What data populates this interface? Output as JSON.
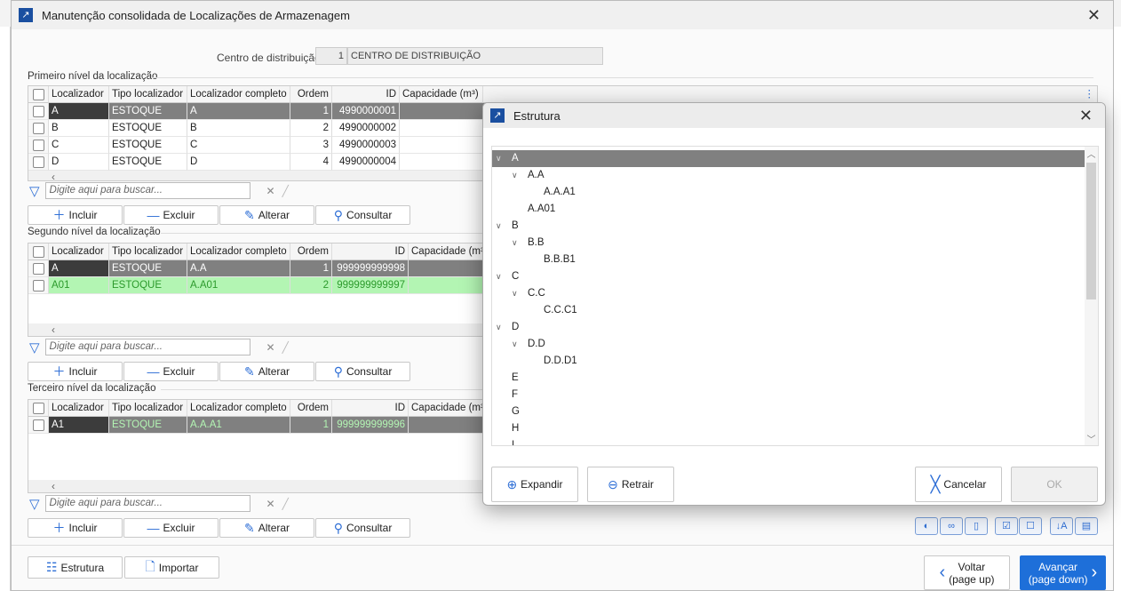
{
  "window": {
    "title": "Manutenção consolidada de Localizações de Armazenagem"
  },
  "distribution": {
    "label": "Centro de distribuição",
    "code": "1",
    "name": "CENTRO DE DISTRIBUIÇÃO"
  },
  "columns": [
    "Localizador",
    "Tipo localizador",
    "Localizador completo",
    "Ordem",
    "ID",
    "Capacidade (m³)"
  ],
  "levels": [
    {
      "title": "Primeiro nível da localização",
      "rows": [
        {
          "localizador": "A",
          "tipo": "ESTOQUE",
          "completo": "A",
          "ordem": "1",
          "id": "4990000001",
          "state": "selected"
        },
        {
          "localizador": "B",
          "tipo": "ESTOQUE",
          "completo": "B",
          "ordem": "2",
          "id": "4990000002",
          "state": "normal"
        },
        {
          "localizador": "C",
          "tipo": "ESTOQUE",
          "completo": "C",
          "ordem": "3",
          "id": "4990000003",
          "state": "normal"
        },
        {
          "localizador": "D",
          "tipo": "ESTOQUE",
          "completo": "D",
          "ordem": "4",
          "id": "4990000004",
          "state": "normal"
        }
      ]
    },
    {
      "title": "Segundo nível da localização",
      "rows": [
        {
          "localizador": "A",
          "tipo": "ESTOQUE",
          "completo": "A.A",
          "ordem": "1",
          "id": "999999999998",
          "state": "selected"
        },
        {
          "localizador": "A01",
          "tipo": "ESTOQUE",
          "completo": "A.A01",
          "ordem": "2",
          "id": "999999999997",
          "state": "green"
        }
      ]
    },
    {
      "title": "Terceiro nível da localização",
      "rows": [
        {
          "localizador": "A1",
          "tipo": "ESTOQUE",
          "completo": "A.A.A1",
          "ordem": "1",
          "id": "999999999996",
          "state": "selected-green"
        }
      ]
    }
  ],
  "search": {
    "placeholder": "Digite aqui para buscar..."
  },
  "actions": {
    "add": "Incluir",
    "delete": "Excluir",
    "edit": "Alterar",
    "query": "Consultar"
  },
  "footer": {
    "structure": "Estrutura",
    "import": "Importar",
    "back": "Voltar",
    "back_sub": "(page up)",
    "next": "Avançar",
    "next_sub": "(page down)"
  },
  "dialog": {
    "title": "Estrutura",
    "tree": [
      {
        "label": "A",
        "depth": 0,
        "expanded": true,
        "selected": true
      },
      {
        "label": "A.A",
        "depth": 1,
        "expanded": true
      },
      {
        "label": "A.A.A1",
        "depth": 2
      },
      {
        "label": "A.A01",
        "depth": 1
      },
      {
        "label": "B",
        "depth": 0,
        "expanded": true
      },
      {
        "label": "B.B",
        "depth": 1,
        "expanded": true
      },
      {
        "label": "B.B.B1",
        "depth": 2
      },
      {
        "label": "C",
        "depth": 0,
        "expanded": true
      },
      {
        "label": "C.C",
        "depth": 1,
        "expanded": true
      },
      {
        "label": "C.C.C1",
        "depth": 2
      },
      {
        "label": "D",
        "depth": 0,
        "expanded": true
      },
      {
        "label": "D.D",
        "depth": 1,
        "expanded": true
      },
      {
        "label": "D.D.D1",
        "depth": 2
      },
      {
        "label": "E",
        "depth": 0
      },
      {
        "label": "F",
        "depth": 0
      },
      {
        "label": "G",
        "depth": 0
      },
      {
        "label": "H",
        "depth": 0
      },
      {
        "label": "I",
        "depth": 0
      }
    ],
    "expand": "Expandir",
    "collapse": "Retrair",
    "cancel": "Cancelar",
    "ok": "OK"
  },
  "colors": {
    "accent": "#1e6fd9",
    "selected_row": "#808080",
    "selected_cell": "#3c3c3c",
    "green_row": "#b3f5b3"
  }
}
